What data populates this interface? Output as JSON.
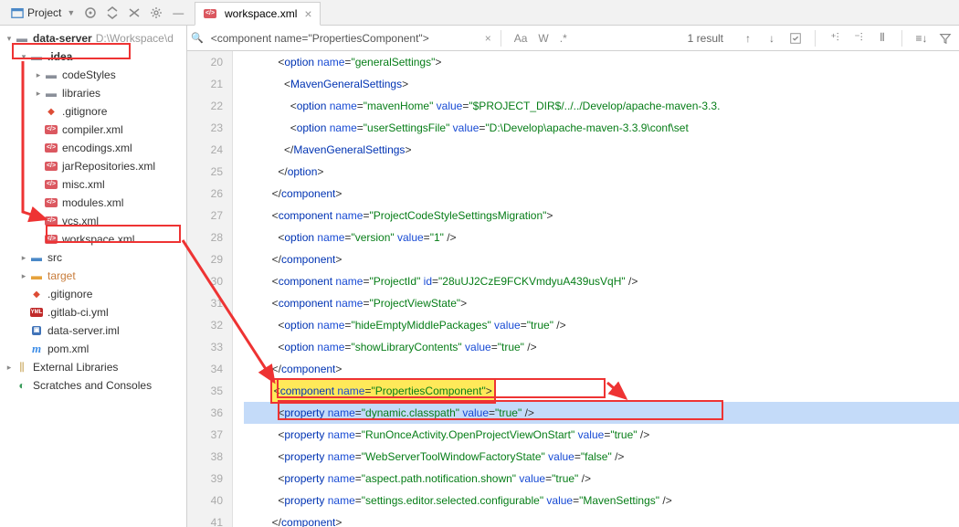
{
  "toolbar": {
    "project_label": "Project"
  },
  "tree": {
    "root": {
      "name": "data-server",
      "path": "D:\\Workspace\\d"
    },
    "idea": {
      "name": ".idea"
    },
    "codeStyles": "codeStyles",
    "libraries": "libraries",
    "gitignore1": ".gitignore",
    "compiler": "compiler.xml",
    "encodings": "encodings.xml",
    "jarRepos": "jarRepositories.xml",
    "misc": "misc.xml",
    "modules": "modules.xml",
    "vcs": "vcs.xml",
    "workspace": "workspace.xml",
    "src": "src",
    "target": "target",
    "gitignore2": ".gitignore",
    "gitlabci": ".gitlab-ci.yml",
    "iml": "data-server.iml",
    "pom": "pom.xml",
    "extlib": "External Libraries",
    "scratches": "Scratches and Consoles"
  },
  "tab": {
    "label": "workspace.xml"
  },
  "find": {
    "query": "<component name=\"PropertiesComponent\">",
    "results": "1 result",
    "opts": {
      "aa": "Aa",
      "w": "W",
      "regex": ".*"
    }
  },
  "code": {
    "lines": [
      {
        "n": 20,
        "ind": 5,
        "t": [
          [
            "punct",
            "<"
          ],
          [
            "tag",
            "option "
          ],
          [
            "attr",
            "name"
          ],
          [
            "punct",
            "="
          ],
          [
            "str",
            "\"generalSettings\""
          ],
          [
            "punct",
            ">"
          ]
        ]
      },
      {
        "n": 21,
        "ind": 6,
        "t": [
          [
            "punct",
            "<"
          ],
          [
            "tag",
            "MavenGeneralSettings"
          ],
          [
            "punct",
            ">"
          ]
        ]
      },
      {
        "n": 22,
        "ind": 7,
        "t": [
          [
            "punct",
            "<"
          ],
          [
            "tag",
            "option "
          ],
          [
            "attr",
            "name"
          ],
          [
            "punct",
            "="
          ],
          [
            "str",
            "\"mavenHome\""
          ],
          [
            "attr",
            " value"
          ],
          [
            "punct",
            "="
          ],
          [
            "str",
            "\"$PROJECT_DIR$/../../Develop/apache-maven-3.3."
          ]
        ]
      },
      {
        "n": 23,
        "ind": 7,
        "t": [
          [
            "punct",
            "<"
          ],
          [
            "tag",
            "option "
          ],
          [
            "attr",
            "name"
          ],
          [
            "punct",
            "="
          ],
          [
            "str",
            "\"userSettingsFile\""
          ],
          [
            "attr",
            " value"
          ],
          [
            "punct",
            "="
          ],
          [
            "str",
            "\"D:\\Develop\\apache-maven-3.3.9\\conf\\set"
          ]
        ]
      },
      {
        "n": 24,
        "ind": 6,
        "t": [
          [
            "punct",
            "</"
          ],
          [
            "tag",
            "MavenGeneralSettings"
          ],
          [
            "punct",
            ">"
          ]
        ]
      },
      {
        "n": 25,
        "ind": 5,
        "t": [
          [
            "punct",
            "</"
          ],
          [
            "tag",
            "option"
          ],
          [
            "punct",
            ">"
          ]
        ]
      },
      {
        "n": 26,
        "ind": 4,
        "t": [
          [
            "punct",
            "</"
          ],
          [
            "tag",
            "component"
          ],
          [
            "punct",
            ">"
          ]
        ]
      },
      {
        "n": 27,
        "ind": 4,
        "t": [
          [
            "punct",
            "<"
          ],
          [
            "tag",
            "component "
          ],
          [
            "attr",
            "name"
          ],
          [
            "punct",
            "="
          ],
          [
            "str",
            "\"ProjectCodeStyleSettingsMigration\""
          ],
          [
            "punct",
            ">"
          ]
        ]
      },
      {
        "n": 28,
        "ind": 5,
        "t": [
          [
            "punct",
            "<"
          ],
          [
            "tag",
            "option "
          ],
          [
            "attr",
            "name"
          ],
          [
            "punct",
            "="
          ],
          [
            "str",
            "\"version\""
          ],
          [
            "attr",
            " value"
          ],
          [
            "punct",
            "="
          ],
          [
            "str",
            "\"1\""
          ],
          [
            "punct",
            " />"
          ]
        ]
      },
      {
        "n": 29,
        "ind": 4,
        "t": [
          [
            "punct",
            "</"
          ],
          [
            "tag",
            "component"
          ],
          [
            "punct",
            ">"
          ]
        ]
      },
      {
        "n": 30,
        "ind": 4,
        "t": [
          [
            "punct",
            "<"
          ],
          [
            "tag",
            "component "
          ],
          [
            "attr",
            "name"
          ],
          [
            "punct",
            "="
          ],
          [
            "str",
            "\"ProjectId\""
          ],
          [
            "attr",
            " id"
          ],
          [
            "punct",
            "="
          ],
          [
            "str",
            "\"28uUJ2CzE9FCKVmdyuA439usVqH\""
          ],
          [
            "punct",
            " />"
          ]
        ]
      },
      {
        "n": 31,
        "ind": 4,
        "t": [
          [
            "punct",
            "<"
          ],
          [
            "tag",
            "component "
          ],
          [
            "attr",
            "name"
          ],
          [
            "punct",
            "="
          ],
          [
            "str",
            "\"ProjectViewState\""
          ],
          [
            "punct",
            ">"
          ]
        ]
      },
      {
        "n": 32,
        "ind": 5,
        "t": [
          [
            "punct",
            "<"
          ],
          [
            "tag",
            "option "
          ],
          [
            "attr",
            "name"
          ],
          [
            "punct",
            "="
          ],
          [
            "str",
            "\"hideEmptyMiddlePackages\""
          ],
          [
            "attr",
            " value"
          ],
          [
            "punct",
            "="
          ],
          [
            "str",
            "\"true\""
          ],
          [
            "punct",
            " />"
          ]
        ]
      },
      {
        "n": 33,
        "ind": 5,
        "t": [
          [
            "punct",
            "<"
          ],
          [
            "tag",
            "option "
          ],
          [
            "attr",
            "name"
          ],
          [
            "punct",
            "="
          ],
          [
            "str",
            "\"showLibraryContents\""
          ],
          [
            "attr",
            " value"
          ],
          [
            "punct",
            "="
          ],
          [
            "str",
            "\"true\""
          ],
          [
            "punct",
            " />"
          ]
        ]
      },
      {
        "n": 34,
        "ind": 4,
        "t": [
          [
            "punct",
            "</"
          ],
          [
            "tag",
            "component"
          ],
          [
            "punct",
            ">"
          ]
        ]
      },
      {
        "n": 35,
        "ind": 4,
        "hl": "yellow",
        "t": [
          [
            "punct",
            "<"
          ],
          [
            "tag",
            "component "
          ],
          [
            "attr",
            "name"
          ],
          [
            "punct",
            "="
          ],
          [
            "str",
            "\"PropertiesComponent\""
          ],
          [
            "punct",
            ">"
          ]
        ]
      },
      {
        "n": 36,
        "ind": 5,
        "hl": "blue",
        "t": [
          [
            "punct",
            "<"
          ],
          [
            "tag",
            "property "
          ],
          [
            "attr",
            "name"
          ],
          [
            "punct",
            "="
          ],
          [
            "str",
            "\"dynamic.classpath\""
          ],
          [
            "attr",
            " value"
          ],
          [
            "punct",
            "="
          ],
          [
            "str",
            "\"true\""
          ],
          [
            "punct",
            " />"
          ]
        ]
      },
      {
        "n": 37,
        "ind": 5,
        "t": [
          [
            "punct",
            "<"
          ],
          [
            "tag",
            "property "
          ],
          [
            "attr",
            "name"
          ],
          [
            "punct",
            "="
          ],
          [
            "str",
            "\"RunOnceActivity.OpenProjectViewOnStart\""
          ],
          [
            "attr",
            " value"
          ],
          [
            "punct",
            "="
          ],
          [
            "str",
            "\"true\""
          ],
          [
            "punct",
            " />"
          ]
        ]
      },
      {
        "n": 38,
        "ind": 5,
        "t": [
          [
            "punct",
            "<"
          ],
          [
            "tag",
            "property "
          ],
          [
            "attr",
            "name"
          ],
          [
            "punct",
            "="
          ],
          [
            "str",
            "\"WebServerToolWindowFactoryState\""
          ],
          [
            "attr",
            " value"
          ],
          [
            "punct",
            "="
          ],
          [
            "str",
            "\"false\""
          ],
          [
            "punct",
            " />"
          ]
        ]
      },
      {
        "n": 39,
        "ind": 5,
        "t": [
          [
            "punct",
            "<"
          ],
          [
            "tag",
            "property "
          ],
          [
            "attr",
            "name"
          ],
          [
            "punct",
            "="
          ],
          [
            "str",
            "\"aspect.path.notification.shown\""
          ],
          [
            "attr",
            " value"
          ],
          [
            "punct",
            "="
          ],
          [
            "str",
            "\"true\""
          ],
          [
            "punct",
            " />"
          ]
        ]
      },
      {
        "n": 40,
        "ind": 5,
        "t": [
          [
            "punct",
            "<"
          ],
          [
            "tag",
            "property "
          ],
          [
            "attr",
            "name"
          ],
          [
            "punct",
            "="
          ],
          [
            "str",
            "\"settings.editor.selected.configurable\""
          ],
          [
            "attr",
            " value"
          ],
          [
            "punct",
            "="
          ],
          [
            "str",
            "\"MavenSettings\""
          ],
          [
            "punct",
            " />"
          ]
        ]
      },
      {
        "n": 41,
        "ind": 4,
        "t": [
          [
            "punct",
            "</"
          ],
          [
            "tag",
            "component"
          ],
          [
            "punct",
            ">"
          ]
        ]
      }
    ]
  }
}
